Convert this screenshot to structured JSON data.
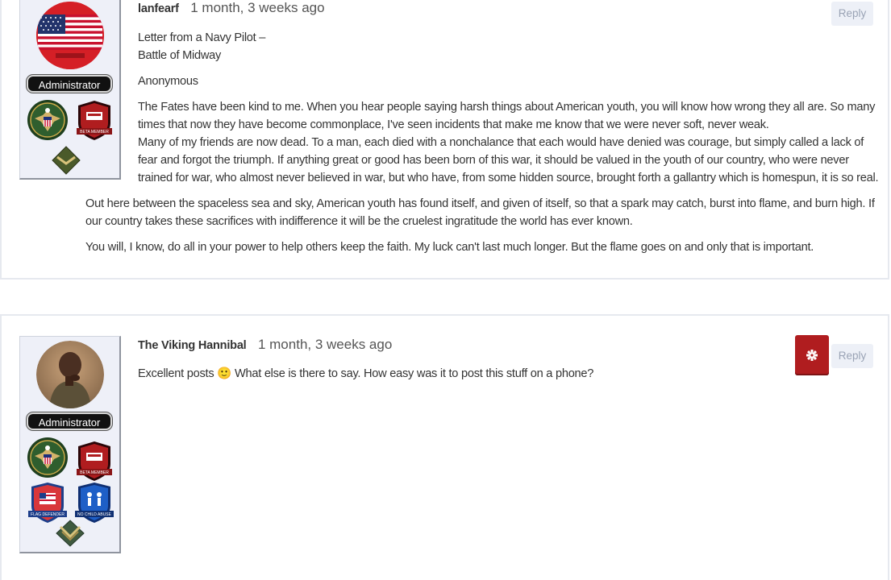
{
  "post1": {
    "author": "lanfearf",
    "timestamp": "1 month, 3 weeks ago",
    "role": "Administrator",
    "reply_label": "Reply",
    "title_line1": "Letter from a Navy Pilot –",
    "title_line2": "Battle of Midway",
    "byline": "Anonymous",
    "body_p1": "The Fates have been kind to me. When you hear people saying harsh things about American youth, you will know how wrong they all are. So many times that now they have become commonplace, I've seen incidents that make me know that we were never soft, never weak.",
    "body_p2": "Many of my friends are now dead. To a man, each died with a nonchalance that each would have denied was courage, but simply called a lack of fear and forgot the triumph. If anything great or good has been born of this war, it should be valued in the youth of our country, who were never trained for war, who almost never believed in war, but who have, from some hidden source, brought forth a gallantry which is homespun, it is so real.",
    "body_p3": "Out here between the spaceless sea and sky, American youth has found itself, and given of itself, so that a spark may catch, burst into flame, and burn high. If our country takes these sacrifices with indifference it will be the cruelest ingratitude the world has ever known.",
    "body_p4": "You will, I know, do all in your power to help others keep the faith. My luck can't last much longer. But the flame goes on and only that is important.",
    "badges": {
      "beta": "BETA MEMBER"
    }
  },
  "post2": {
    "author": "The Viking Hannibal",
    "timestamp": "1 month, 3 weeks ago",
    "role": "Administrator",
    "reply_label": "Reply",
    "body_before_emoji": "Excellent posts",
    "emoji": "🙂",
    "body_after_emoji": "What else is there to say. How easy was it to post this stuff on a phone?",
    "badges": {
      "beta": "BETA MEMBER",
      "flag": "FLAG DEFENDER",
      "child": "NO CHILD ABUSE"
    }
  },
  "colors": {
    "accent_red": "#b01d1f",
    "reply_bg": "#edf0f7",
    "card_bg": "#eef0f8"
  },
  "icons": [
    "us-flag-avatar",
    "great-seal-icon",
    "beta-member-shield-icon",
    "chevron-rank-icon",
    "flag-defender-shield-icon",
    "no-child-abuse-shield-icon",
    "gear-icon"
  ]
}
